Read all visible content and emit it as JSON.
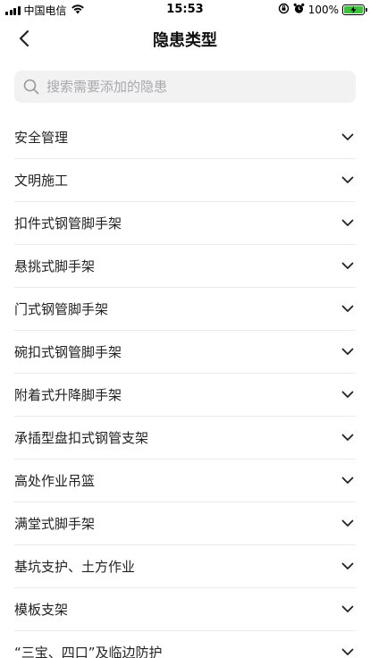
{
  "status_bar": {
    "carrier": "中国电信",
    "time": "15:53",
    "battery_percent": "100%"
  },
  "header": {
    "title": "隐患类型",
    "back_icon": "chevron-left-icon"
  },
  "search": {
    "placeholder": "搜索需要添加的隐患",
    "value": ""
  },
  "categories": [
    {
      "label": "安全管理"
    },
    {
      "label": "文明施工"
    },
    {
      "label": "扣件式钢管脚手架"
    },
    {
      "label": "悬挑式脚手架"
    },
    {
      "label": "门式钢管脚手架"
    },
    {
      "label": "碗扣式钢管脚手架"
    },
    {
      "label": "附着式升降脚手架"
    },
    {
      "label": "承插型盘扣式钢管支架"
    },
    {
      "label": "高处作业吊篮"
    },
    {
      "label": "满堂式脚手架"
    },
    {
      "label": "基坑支护、土方作业"
    },
    {
      "label": "模板支架"
    },
    {
      "label": "“三宝、四口”及临边防护"
    }
  ],
  "colors": {
    "battery_fill": "#3cc13b",
    "search_bg": "#f2f2f3",
    "divider": "#ececec"
  }
}
